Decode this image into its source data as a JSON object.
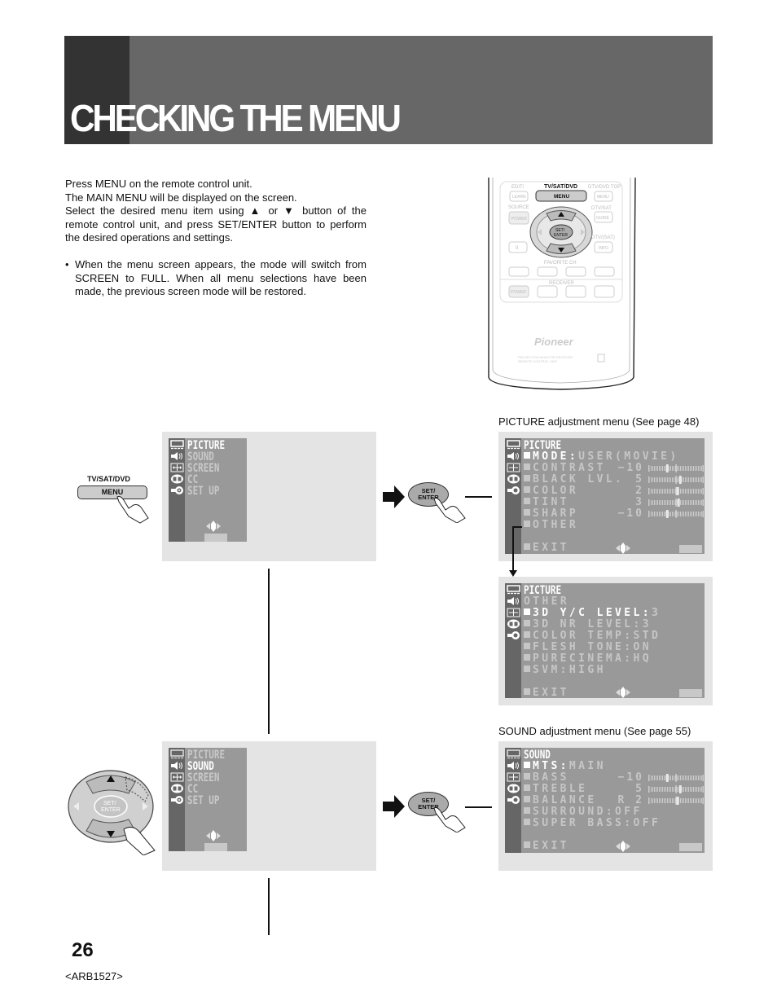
{
  "page": {
    "title": "CHECKING THE MENU",
    "page_number": "26",
    "doc_code": "<ARB1527>"
  },
  "intro": {
    "paragraph": "Press MENU on the remote control unit. The MAIN MENU will be displayed on the screen. Select the desired menu item using ▲ or ▼ button of the remote control unit, and press SET/ENTER button to perform the desired operations and settings.",
    "line1": "Press MENU on the remote control unit.",
    "line2": "The MAIN MENU will be displayed on the screen.",
    "line3": "Select the desired menu item using ▲ or ▼ button of the remote control unit, and press SET/ENTER button to perform the desired operations and settings.",
    "bullet_mark": "•",
    "bullet": "When the menu screen appears, the mode will switch from SCREEN to FULL. When all menu selections have been made, the previous screen mode will be restored."
  },
  "remote": {
    "labels": {
      "edit": "EDIT/",
      "learn": "LEARN",
      "tv_sat_dvd": "TV/SAT/DVD",
      "menu": "MENU",
      "dtv_dvd_top": "DTV/DVD TOP",
      "menu2": "MENU",
      "source": "SOURCE",
      "power": "POWER",
      "dtv_sat": "DTV/SAT",
      "guide": "GUIDE",
      "set": "SET/",
      "enter": "ENTER",
      "dtv_isat": "DTV/(SAT)",
      "info": "INFO",
      "favorite": "FAVORITE CH",
      "receiver": "RECEIVER",
      "power2": "POWER",
      "minus": "−",
      "plus": "+",
      "brand": "Pioneer",
      "fine1": "PROJECTION MONITOR RECEIVER",
      "fine2": "REMOTE CONTROL UNIT"
    }
  },
  "steps": {
    "menu_button": {
      "top": "TV/SAT/DVD",
      "label": "MENU"
    },
    "set_enter": {
      "line1": "SET/",
      "line2": "ENTER"
    }
  },
  "main_menu_icons": [
    "tv-icon",
    "speaker-icon",
    "screen-icon",
    "cc-icon",
    "setup-icon"
  ],
  "main_menu_1": {
    "items": [
      "PICTURE",
      "SOUND",
      "SCREEN",
      "CC",
      "SET UP"
    ],
    "selected": "PICTURE"
  },
  "main_menu_2": {
    "items": [
      "PICTURE",
      "SOUND",
      "SCREEN",
      "CC",
      "SET UP"
    ],
    "selected": "SOUND"
  },
  "picture_menu": {
    "caption": "PICTURE adjustment menu (See page 48)",
    "header": "PICTURE",
    "mode_label": "MODE:",
    "mode_value": "USER(MOVIE)",
    "rows": [
      {
        "label": "CONTRAST",
        "value": "−10",
        "level": -10
      },
      {
        "label": "BLACK LVL.",
        "value": "5",
        "level": 5
      },
      {
        "label": "COLOR",
        "value": "2",
        "level": 2
      },
      {
        "label": "TINT",
        "value": "3",
        "level": 3
      },
      {
        "label": "SHARP",
        "value": "−10",
        "level": -10
      }
    ],
    "other": "OTHER",
    "exit": "EXIT"
  },
  "picture_other_menu": {
    "header": "PICTURE",
    "subheader": "OTHER",
    "active_label": "3D Y/C LEVEL:",
    "active_value": "3",
    "rows": [
      "3D NR LEVEL:3",
      "COLOR TEMP:STD",
      "FLESH TONE:ON",
      "PURECINEMA:HQ",
      "SVM:HIGH"
    ],
    "exit": "EXIT"
  },
  "sound_menu": {
    "caption": "SOUND adjustment menu (See page 55)",
    "header": "SOUND",
    "mts_label": "MTS:",
    "mts_value": "MAIN",
    "rows": [
      {
        "label": "BASS",
        "value": "−10",
        "level": -10
      },
      {
        "label": "TREBLE",
        "value": "5",
        "level": 5
      },
      {
        "label": "BALANCE",
        "value": "R  2",
        "level": 2
      }
    ],
    "surround": "SURROUND:OFF",
    "super_bass": "SUPER BASS:OFF",
    "exit": "EXIT"
  },
  "colors": {
    "banner": "#676767",
    "banner_tab": "#333333",
    "panel_bg": "#e4e4e4",
    "osd_bg": "#999999",
    "osd_iconcol": "#666666",
    "osd_text_dim": "#c6c6c6",
    "osd_text_active": "#ffffff"
  }
}
